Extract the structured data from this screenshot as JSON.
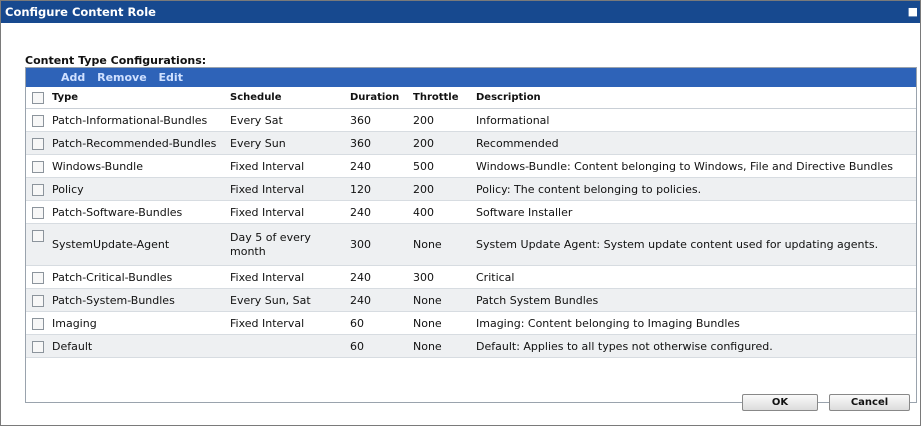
{
  "dialog": {
    "title": "Configure Content Role",
    "close_glyph": "■"
  },
  "section_label": "Content Type Configurations:",
  "toolbar": {
    "add": "Add",
    "remove": "Remove",
    "edit": "Edit"
  },
  "columns": {
    "type": "Type",
    "schedule": "Schedule",
    "duration": "Duration",
    "throttle": "Throttle",
    "description": "Description"
  },
  "rows": [
    {
      "type": "Patch-Informational-Bundles",
      "schedule": "Every Sat",
      "duration": "360",
      "throttle": "200",
      "description": "Informational"
    },
    {
      "type": "Patch-Recommended-Bundles",
      "schedule": "Every Sun",
      "duration": "360",
      "throttle": "200",
      "description": "Recommended"
    },
    {
      "type": "Windows-Bundle",
      "schedule": "Fixed Interval",
      "duration": "240",
      "throttle": "500",
      "description": "Windows-Bundle: Content belonging to Windows, File and Directive Bundles"
    },
    {
      "type": "Policy",
      "schedule": "Fixed Interval",
      "duration": "120",
      "throttle": "200",
      "description": "Policy: The content belonging to policies."
    },
    {
      "type": "Patch-Software-Bundles",
      "schedule": "Fixed Interval",
      "duration": "240",
      "throttle": "400",
      "description": "Software Installer"
    },
    {
      "type": "SystemUpdate-Agent",
      "schedule": "Day 5 of every month",
      "duration": "300",
      "throttle": "None",
      "description": "System Update Agent: System update content used for updating agents."
    },
    {
      "type": "Patch-Critical-Bundles",
      "schedule": "Fixed Interval",
      "duration": "240",
      "throttle": "300",
      "description": "Critical"
    },
    {
      "type": "Patch-System-Bundles",
      "schedule": "Every Sun, Sat",
      "duration": "240",
      "throttle": "None",
      "description": "Patch System Bundles"
    },
    {
      "type": "Imaging",
      "schedule": "Fixed Interval",
      "duration": "60",
      "throttle": "None",
      "description": "Imaging: Content belonging to Imaging Bundles"
    },
    {
      "type": "Default",
      "schedule": "",
      "duration": "60",
      "throttle": "None",
      "description": "Default: Applies to all types not otherwise configured."
    }
  ],
  "buttons": {
    "ok": "OK",
    "cancel": "Cancel"
  }
}
